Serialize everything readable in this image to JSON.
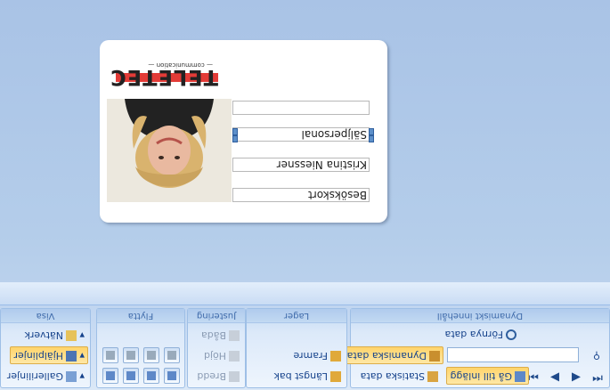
{
  "ribbon": {
    "groups": {
      "dynamic": {
        "label": "Dynamiskt innehåll"
      },
      "layers": {
        "label": "Lager"
      },
      "align": {
        "label": "Justering"
      },
      "move": {
        "label": "Flytta"
      },
      "view": {
        "label": "Visa"
      }
    },
    "buttons": {
      "refresh_data": "Förnya data",
      "dynamic_data": "Dynamiska data",
      "static_data": "Statiska data",
      "goto_record": "Gå till inlägg",
      "bring_forward": "Framre",
      "send_back": "Längst bak",
      "width": "Bredd",
      "height": "Höjd",
      "both": "Båda",
      "grid": "Nätverk",
      "guides": "Hjälplinjer",
      "gallery": "Gallerilinjer"
    }
  },
  "card": {
    "logo_text": "TELETEC",
    "logo_tagline": "— communication —",
    "fields": {
      "type": "Besökskort",
      "name": "Kristina Niessner",
      "role": "Säljpersonal",
      "empty": ""
    }
  },
  "colors": {
    "accent": "#ffd46b",
    "logo_red": "#e33b37",
    "ribbon_text": "#15428b"
  }
}
